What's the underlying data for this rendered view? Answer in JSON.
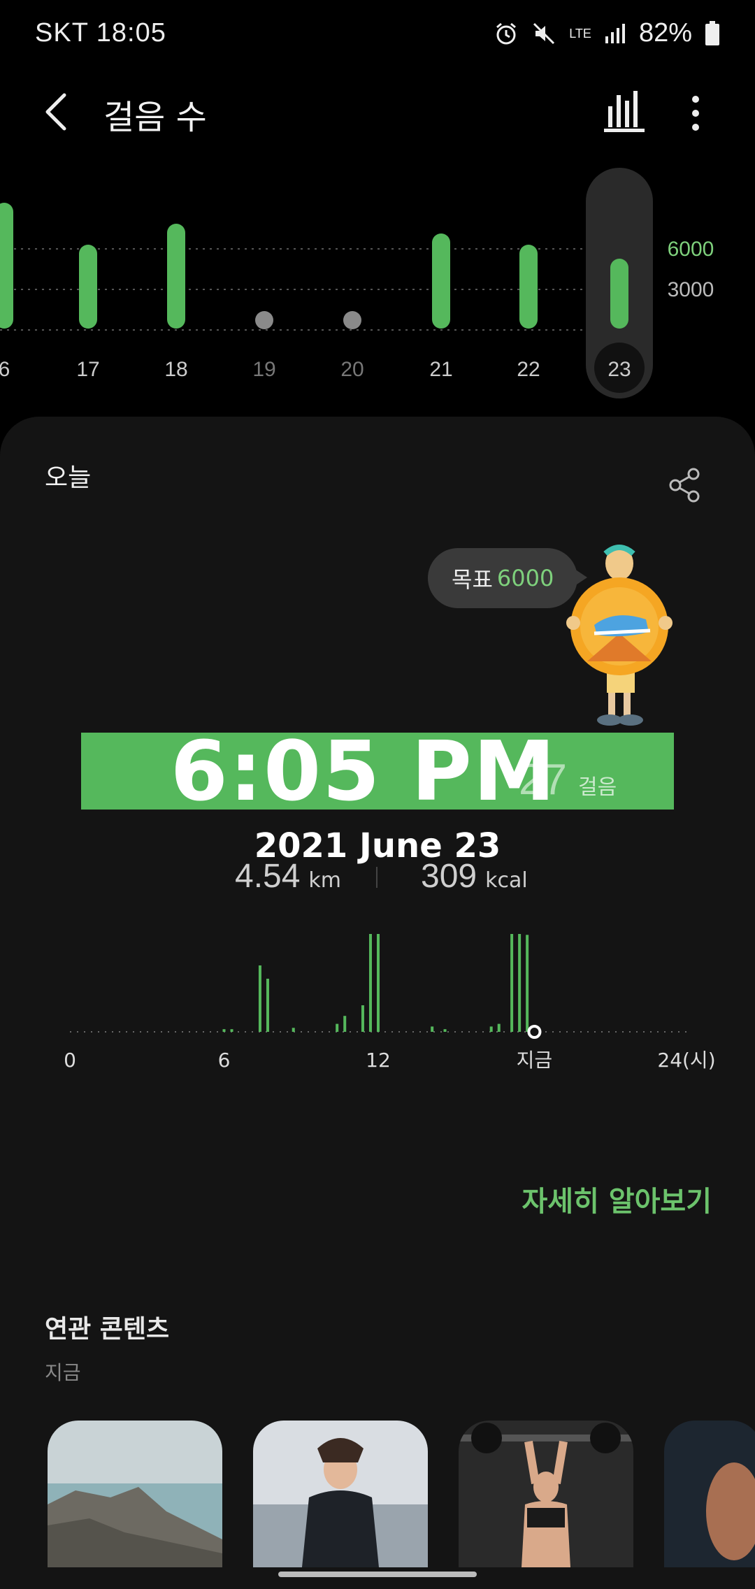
{
  "status_bar": {
    "carrier_time": "SKT 18:05",
    "network": "LTE",
    "battery": "82%"
  },
  "header": {
    "title": "걸음 수",
    "icons": [
      "back-icon",
      "bar-chart-icon",
      "more-vertical-icon"
    ]
  },
  "weekly_chart": {
    "days": [
      {
        "label": "6",
        "steps_level": 0.9,
        "has_data": true
      },
      {
        "label": "17",
        "steps_level": 0.6,
        "has_data": true
      },
      {
        "label": "18",
        "steps_level": 0.75,
        "has_data": true
      },
      {
        "label": "19",
        "steps_level": 0,
        "has_data": false
      },
      {
        "label": "20",
        "steps_level": 0,
        "has_data": false
      },
      {
        "label": "21",
        "steps_level": 0.68,
        "has_data": true
      },
      {
        "label": "22",
        "steps_level": 0.6,
        "has_data": true
      },
      {
        "label": "23",
        "steps_level": 0.5,
        "has_data": true,
        "selected": true
      }
    ],
    "gridlines": [
      "6000",
      "3000"
    ],
    "colors": {
      "bar": "#55b85c",
      "empty": "#8a8a8a",
      "selected_bg": "#2a2a2a"
    }
  },
  "today": {
    "label": "오늘",
    "goal_label": "목표",
    "goal_value": "6000",
    "time_overlay": "6:05 PM",
    "date_overlay": "2021 June 23",
    "steps_partial": "27",
    "steps_unit": "걸음",
    "distance": "4.54",
    "distance_unit": "km",
    "calories": "309",
    "calories_unit": "kcal"
  },
  "day_chart": {
    "axis_labels": [
      "0",
      "6",
      "12",
      "지금",
      "24(시)"
    ],
    "bars": [
      {
        "hour": 6.0,
        "level": 0.02
      },
      {
        "hour": 6.3,
        "level": 0.02
      },
      {
        "hour": 7.4,
        "level": 0.5
      },
      {
        "hour": 7.7,
        "level": 0.4
      },
      {
        "hour": 8.7,
        "level": 0.03
      },
      {
        "hour": 10.4,
        "level": 0.06
      },
      {
        "hour": 10.7,
        "level": 0.12
      },
      {
        "hour": 11.4,
        "level": 0.2
      },
      {
        "hour": 11.7,
        "level": 0.78
      },
      {
        "hour": 12.0,
        "level": 1.0
      },
      {
        "hour": 14.1,
        "level": 0.04
      },
      {
        "hour": 14.6,
        "level": 0.02
      },
      {
        "hour": 16.4,
        "level": 0.04
      },
      {
        "hour": 16.7,
        "level": 0.06
      },
      {
        "hour": 17.2,
        "level": 0.8
      },
      {
        "hour": 17.5,
        "level": 0.84
      },
      {
        "hour": 17.8,
        "level": 0.73
      }
    ],
    "now_hour": 18.08
  },
  "learn_more": "자세히 알아보기",
  "related": {
    "title": "연관 콘텐츠",
    "subtitle": "지금"
  }
}
